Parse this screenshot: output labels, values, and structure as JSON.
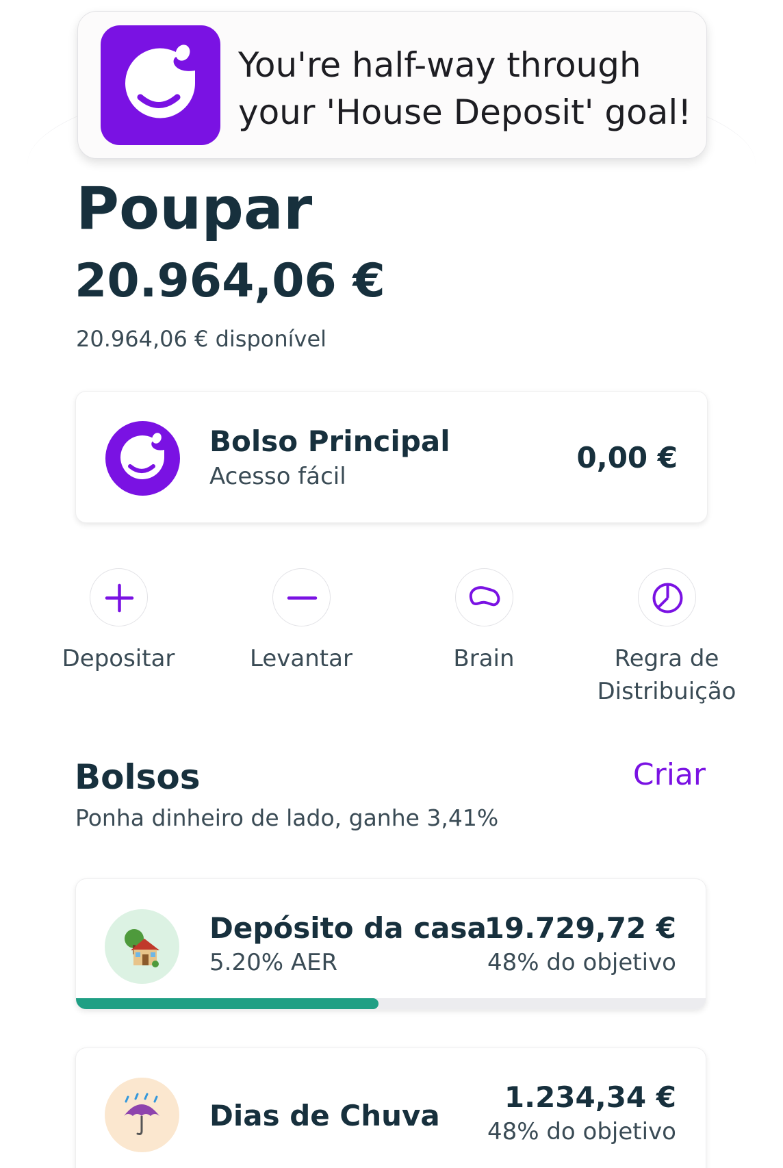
{
  "notification": {
    "line1": "You're half-way through",
    "line2": "your 'House Deposit' goal!"
  },
  "header": {
    "title": "Poupar",
    "balance": "20.964,06 €",
    "available": "20.964,06 € disponível"
  },
  "main_pocket": {
    "title": "Bolso Principal",
    "subtitle": "Acesso fácil",
    "amount": "0,00 €"
  },
  "actions": [
    {
      "label": "Depositar",
      "icon": "plus-icon"
    },
    {
      "label": "Levantar",
      "icon": "minus-icon"
    },
    {
      "label": "Brain",
      "icon": "brain-icon"
    },
    {
      "label": "Regra de Distribuição",
      "icon": "pie-chart-icon"
    }
  ],
  "pockets_section": {
    "title": "Bolsos",
    "create_label": "Criar",
    "subtitle": "Ponha dinheiro de lado, ganhe 3,41%"
  },
  "pockets": [
    {
      "name": "Depósito da casa",
      "rate": "5.20% AER",
      "amount": "19.729,72 €",
      "goal": "48% do objetivo",
      "progress": 0.48,
      "icon": "house-icon"
    },
    {
      "name": "Dias de Chuva",
      "amount": "1.234,34 €",
      "goal": "48% do objetivo",
      "icon": "umbrella-rain-icon"
    }
  ],
  "colors": {
    "brand": "#7a12e3",
    "text": "#17303d",
    "progress": "#1f9f84"
  }
}
